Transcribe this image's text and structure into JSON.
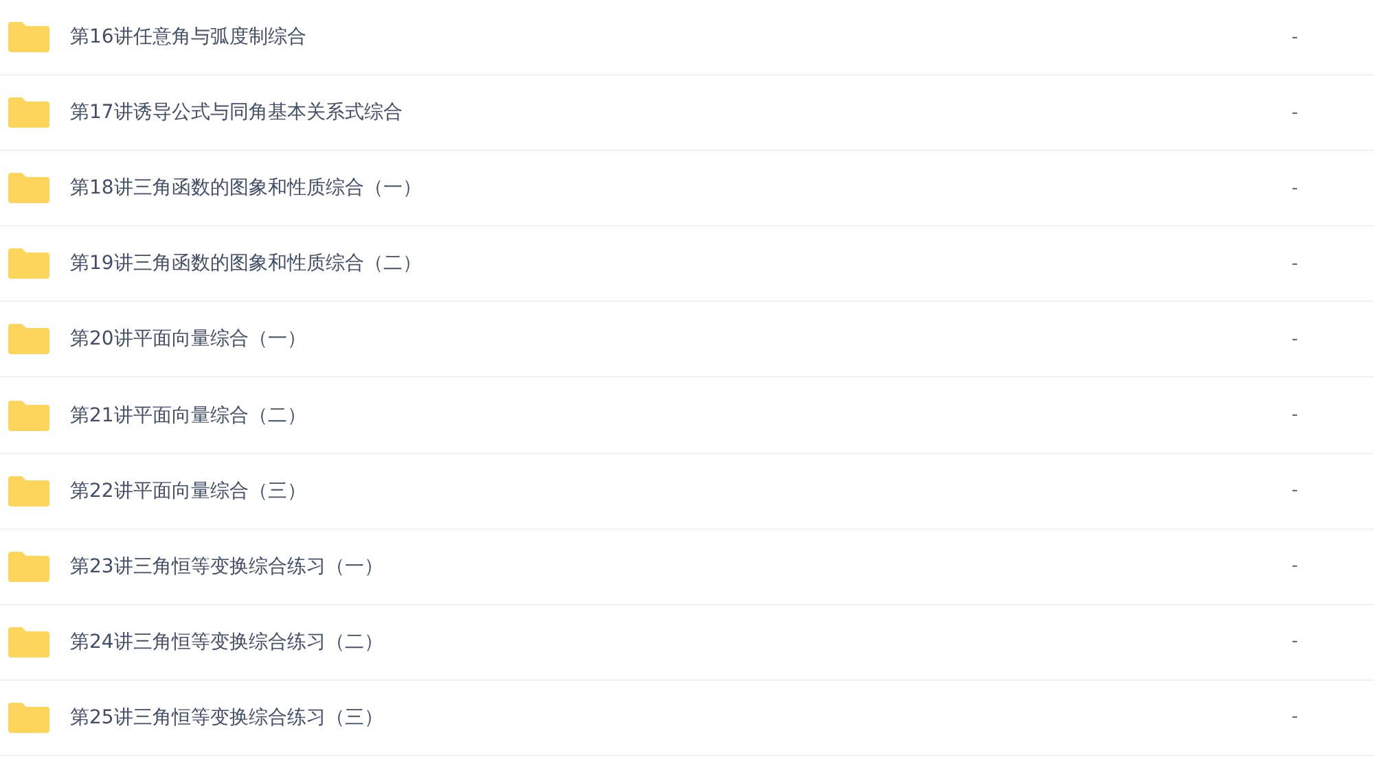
{
  "files": [
    {
      "name": "第16讲任意角与弧度制综合",
      "size": "-"
    },
    {
      "name": "第17讲诱导公式与同角基本关系式综合",
      "size": "-"
    },
    {
      "name": "第18讲三角函数的图象和性质综合（一）",
      "size": "-"
    },
    {
      "name": "第19讲三角函数的图象和性质综合（二）",
      "size": "-"
    },
    {
      "name": "第20讲平面向量综合（一）",
      "size": "-"
    },
    {
      "name": "第21讲平面向量综合（二）",
      "size": "-"
    },
    {
      "name": "第22讲平面向量综合（三）",
      "size": "-"
    },
    {
      "name": "第23讲三角恒等变换综合练习（一）",
      "size": "-"
    },
    {
      "name": "第24讲三角恒等变换综合练习（二）",
      "size": "-"
    },
    {
      "name": "第25讲三角恒等变换综合练习（三）",
      "size": "-"
    }
  ]
}
